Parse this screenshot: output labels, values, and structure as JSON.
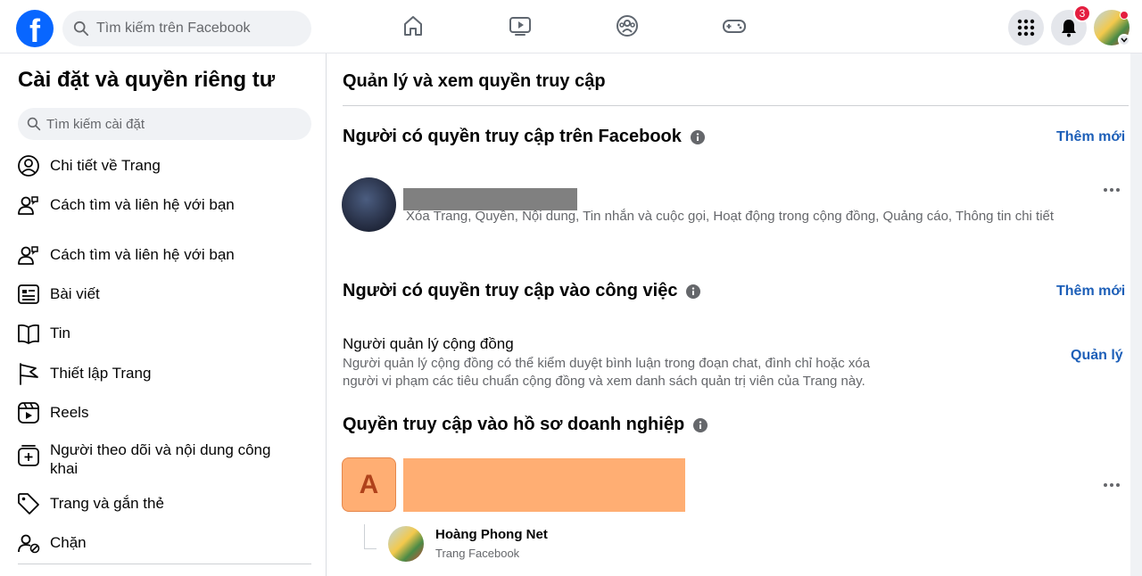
{
  "topbar": {
    "logo": "f",
    "search_placeholder": "Tìm kiếm trên Facebook",
    "nav_icons": [
      "home-icon",
      "video-icon",
      "groups-icon",
      "gaming-icon"
    ],
    "notification_count": "3"
  },
  "sidebar": {
    "title": "Cài đặt và quyền riêng tư",
    "search_placeholder": "Tìm kiếm cài đặt",
    "items": [
      {
        "label": "Chi tiết về Trang",
        "icon": "user-circle-icon"
      },
      {
        "label": "Cách tìm và liên hệ với bạn",
        "icon": "contact-icon"
      },
      {
        "label": "Cách tìm và liên hệ với bạn",
        "icon": "contact-icon"
      },
      {
        "label": "Bài viết",
        "icon": "posts-icon"
      },
      {
        "label": "Tin",
        "icon": "book-icon"
      },
      {
        "label": "Thiết lập Trang",
        "icon": "flag-icon"
      },
      {
        "label": "Reels",
        "icon": "reels-icon"
      },
      {
        "label": "Người theo dõi và nội dung công khai",
        "icon": "add-box-icon"
      },
      {
        "label": "Trang và gắn thẻ",
        "icon": "tag-icon"
      },
      {
        "label": "Chặn",
        "icon": "block-user-icon"
      }
    ]
  },
  "main": {
    "title": "Quản lý và xem quyền truy cập",
    "facebook_access": {
      "title": "Người có quyền truy cập trên Facebook",
      "add_label": "Thêm mới",
      "permissions": "Xóa Trang, Quyền, Nội dung, Tin nhắn và cuộc gọi, Hoạt động trong cộng đồng, Quảng cáo, Thông tin chi tiết"
    },
    "task_access": {
      "title": "Người có quyền truy cập vào công việc",
      "add_label": "Thêm mới",
      "role_title": "Người quản lý cộng đồng",
      "role_desc": "Người quản lý cộng đồng có thể kiểm duyệt bình luận trong đoạn chat, đình chỉ hoặc xóa người vi phạm các tiêu chuẩn cộng đồng và xem danh sách quản trị viên của Trang này.",
      "manage_label": "Quản lý"
    },
    "business_access": {
      "title": "Quyền truy cập vào hồ sơ doanh nghiệp",
      "avatar_letter": "A",
      "page_name": "Hoàng Phong Net",
      "page_type": "Trang Facebook"
    }
  },
  "colors": {
    "brand": "#0866ff",
    "link": "#1d5fb8",
    "badge": "#e41e3f",
    "business_avatar": "#ffae73"
  }
}
